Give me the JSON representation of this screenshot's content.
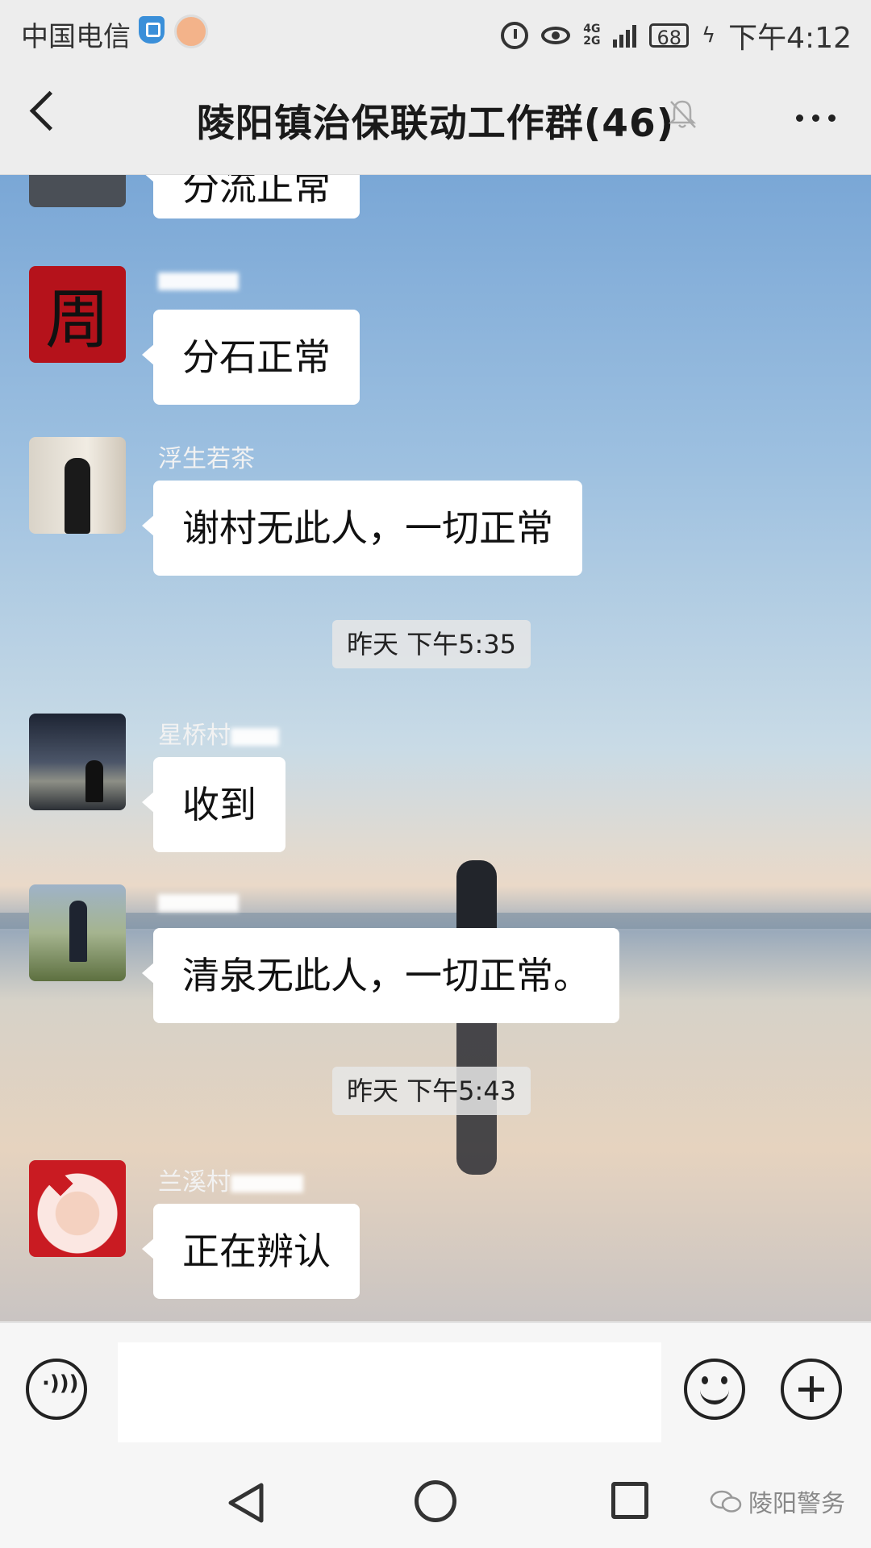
{
  "status_bar": {
    "carrier": "中国电信",
    "network_top": "4G",
    "network_bottom": "2G",
    "battery": "68",
    "time": "下午4:12"
  },
  "header": {
    "title": "陵阳镇治保联动工作群(46)"
  },
  "messages": [
    {
      "sender": "",
      "text": "分流正常"
    },
    {
      "sender": "",
      "text": "分石正常",
      "avatar_char": "周"
    },
    {
      "sender": "浮生若茶",
      "text": "谢村无此人，一切正常"
    },
    {
      "sender": "星桥村",
      "text": "收到"
    },
    {
      "sender": "",
      "text": "清泉无此人，一切正常。"
    },
    {
      "sender": "兰溪村",
      "text": "正在辨认"
    }
  ],
  "timestamps": [
    "昨天 下午5:35",
    "昨天 下午5:43"
  ],
  "watermark": "陵阳警务",
  "colors": {
    "bubble": "#ffffff",
    "accent_seal": "#b5121b"
  }
}
